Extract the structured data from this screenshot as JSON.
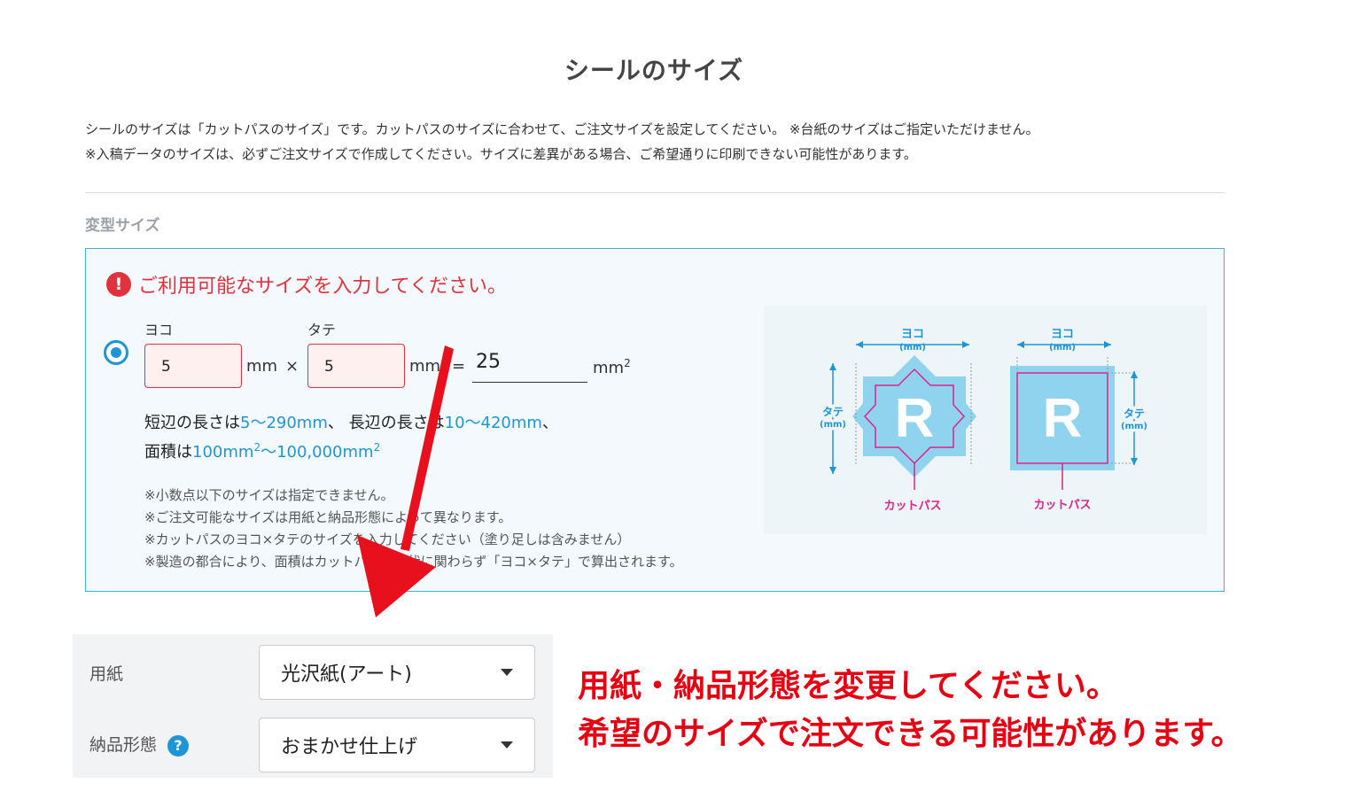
{
  "page_title": "シールのサイズ",
  "description": [
    "シールのサイズは「カットパスのサイズ」です。カットパスのサイズに合わせて、ご注文サイズを設定してください。 ※台紙のサイズはご指定いただけません。",
    "※入稿データのサイズは、必ずご注文サイズで作成してください。サイズに差異がある場合、ご希望通りに印刷できない可能性があります。"
  ],
  "custom_size": {
    "section_label": "変型サイズ",
    "warning": "ご利用可能なサイズを入力してください。",
    "warning_icon": "!",
    "width_label": "ヨコ",
    "height_label": "タテ",
    "width_value": "5",
    "height_value": "5",
    "unit_mm": "mm",
    "times": "×",
    "equals": "=",
    "area_value": "25",
    "area_unit": "mm",
    "area_unit_sup": "2",
    "range_line1": {
      "a": "短辺の長さは",
      "b": "5〜290mm",
      "c": "、 長辺の長さは",
      "d": "10〜420mm",
      "e": "、"
    },
    "range_line2": {
      "a": "面積は",
      "b": "100mm",
      "b_sup": "2",
      "c": "〜100,000mm",
      "c_sup": "2"
    },
    "notes": [
      "※小数点以下のサイズは指定できません。",
      "※ご注文可能なサイズは用紙と納品形態によって異なります。",
      "※カットパスのヨコ×タテのサイズを入力してください（塗り足しは含みません）",
      "※製造の都合により、面積はカットパスの形状に関わらず「ヨコ×タテ」で算出されます。"
    ]
  },
  "diagram": {
    "yoko": "ヨコ",
    "mm": "(mm)",
    "tate": "タテ",
    "letter": "R",
    "cutpath": "カットパス",
    "colors": {
      "fill": "#8fd3ef",
      "cut": "#e0218a",
      "guide": "#1e96d6"
    }
  },
  "options": {
    "paper_label": "用紙",
    "paper_value": "光沢紙(アート)",
    "delivery_label": "納品形態",
    "delivery_help": "?",
    "delivery_value": "おまかせ仕上げ"
  },
  "callout": [
    "用紙・納品形態を変更してください。",
    "希望のサイズで注文できる可能性があります。"
  ],
  "colors": {
    "accent": "#1e96d6",
    "error": "#e0333e",
    "callout": "#e60012",
    "arrow": "#e8101c"
  }
}
